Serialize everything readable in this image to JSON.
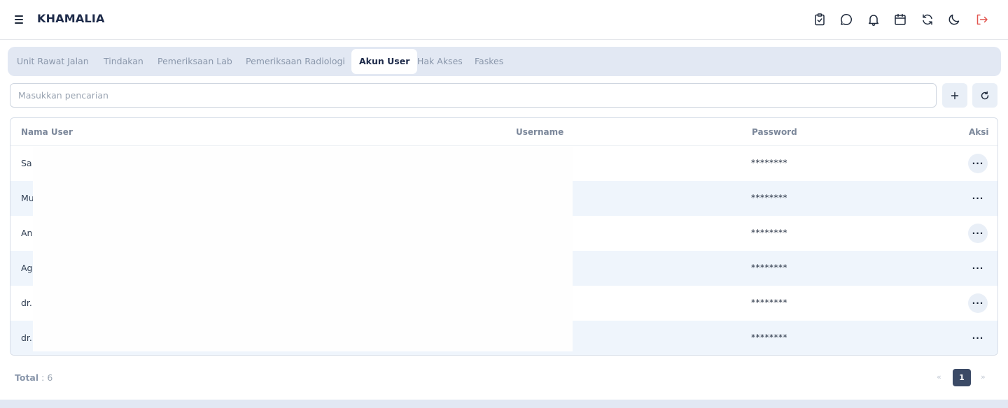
{
  "header": {
    "brand": "KHAMALIA",
    "icons": [
      "clipboard-check-icon",
      "chat-icon",
      "bell-icon",
      "calendar-icon",
      "refresh-icon",
      "moon-icon",
      "logout-icon"
    ]
  },
  "tabs": [
    {
      "label": "Unit Rawat Jalan"
    },
    {
      "label": "Tindakan"
    },
    {
      "label": "Pemeriksaan Lab"
    },
    {
      "label": "Pemeriksaan Radiologi"
    },
    {
      "label": "Akun User",
      "active": true
    },
    {
      "label": "Hak Akses"
    },
    {
      "label": "Faskes"
    }
  ],
  "search": {
    "placeholder": "Masukkan pencarian"
  },
  "table": {
    "headers": {
      "name": "Nama User",
      "username": "Username",
      "password": "Password",
      "action": "Aksi"
    },
    "rows": [
      {
        "name": "Sa",
        "password": "********"
      },
      {
        "name": "Mu",
        "password": "********"
      },
      {
        "name": "An",
        "password": "********"
      },
      {
        "name": "Ag",
        "password": "********"
      },
      {
        "name": "dr.",
        "password": "********"
      },
      {
        "name": "dr.",
        "password": "********"
      }
    ],
    "action_label": "···"
  },
  "footer": {
    "total_label": "Total",
    "total_sep": " : ",
    "total_value": "6"
  },
  "pagination": {
    "prev": "«",
    "current": "1",
    "next": "»"
  },
  "colors": {
    "accent": "#3b4a66",
    "logout": "#e2554f",
    "tabbar": "#e2e8f3",
    "row_alt": "#eff5fc"
  }
}
